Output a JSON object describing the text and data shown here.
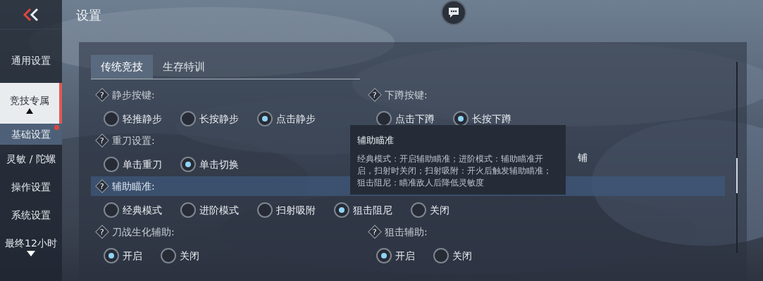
{
  "header": {
    "title": "设置"
  },
  "sidebar": {
    "items": [
      {
        "label": "通用设置",
        "selected": false,
        "kind": "main",
        "dot": false,
        "arrow_up": false,
        "arrow_down": false
      },
      {
        "label": "竞技专属",
        "selected": true,
        "kind": "main",
        "dot": false,
        "arrow_up": true,
        "arrow_down": false
      },
      {
        "label": "基础设置",
        "selected": true,
        "kind": "sub",
        "dot": true,
        "arrow_up": false,
        "arrow_down": false
      },
      {
        "label": "灵敏 / 陀螺",
        "selected": false,
        "kind": "sub",
        "dot": false,
        "arrow_up": false,
        "arrow_down": false
      },
      {
        "label": "操作设置",
        "selected": false,
        "kind": "sub",
        "dot": false,
        "arrow_up": false,
        "arrow_down": false
      },
      {
        "label": "系统设置",
        "selected": false,
        "kind": "sub",
        "dot": false,
        "arrow_up": false,
        "arrow_down": false
      },
      {
        "label": "最终12小时",
        "selected": false,
        "kind": "main",
        "dot": false,
        "arrow_up": false,
        "arrow_down": true
      }
    ]
  },
  "tabs": [
    {
      "label": "传统竞技",
      "selected": true
    },
    {
      "label": "生存特训",
      "selected": false
    }
  ],
  "rows": [
    {
      "highlighted": false,
      "left": {
        "help": "?",
        "label": "静步按键:",
        "options": [
          {
            "label": "轻推静步",
            "selected": false
          },
          {
            "label": "长按静步",
            "selected": false
          },
          {
            "label": "点击静步",
            "selected": true
          }
        ]
      },
      "right": {
        "kind": "setting",
        "help": "?",
        "label": "下蹲按键:",
        "options": [
          {
            "label": "点击下蹲",
            "selected": false
          },
          {
            "label": "长按下蹲",
            "selected": true
          }
        ]
      }
    },
    {
      "highlighted": false,
      "left": {
        "help": "?",
        "label": "重刀设置:",
        "options": [
          {
            "label": "单击重刀",
            "selected": false
          },
          {
            "label": "单击切换",
            "selected": true
          }
        ]
      },
      "right": {
        "kind": "covered",
        "partial_text": "铺"
      }
    },
    {
      "highlighted": true,
      "left": {
        "help": "?",
        "label": "辅助瞄准:",
        "options": [
          {
            "label": "经典模式",
            "selected": false
          },
          {
            "label": "进阶模式",
            "selected": false
          },
          {
            "label": "扫射吸附",
            "selected": false
          },
          {
            "label": "狙击阻尼",
            "selected": true
          },
          {
            "label": "关闭",
            "selected": false
          }
        ]
      },
      "right": null
    },
    {
      "highlighted": false,
      "left": {
        "help": "?",
        "label": "刀战生化辅助:",
        "options": [
          {
            "label": "开启",
            "selected": true
          },
          {
            "label": "关闭",
            "selected": false
          }
        ]
      },
      "right": {
        "kind": "setting",
        "help": "?",
        "label": "狙击辅助:",
        "options": [
          {
            "label": "开启",
            "selected": true
          },
          {
            "label": "关闭",
            "selected": false
          }
        ]
      }
    }
  ],
  "tooltip": {
    "title": "辅助瞄准",
    "body": "经典模式：开启辅助瞄准；进阶模式：辅助瞄准开启，扫射时关闭；扫射吸附：开火后触发辅助瞄准；狙击阻尼：瞄准敌人后降低灵敏度"
  }
}
